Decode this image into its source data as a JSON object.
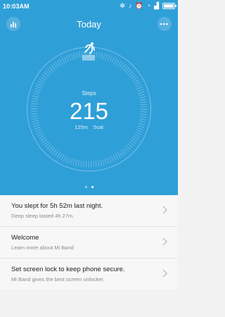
{
  "status": {
    "time": "10:03AM"
  },
  "header": {
    "title": "Today"
  },
  "activity": {
    "steps_label": "Steps",
    "steps": "215",
    "distance": "125m",
    "calories": "5cal",
    "page_count": 2,
    "active_page": 2
  },
  "cards": [
    {
      "title": "You slept for 5h 52m last night.",
      "subtitle": "Deep sleep lasted 4h 27m."
    },
    {
      "title": "Welcome",
      "subtitle": "Learn more about Mi Band"
    },
    {
      "title": "Set screen lock to keep phone secure.",
      "subtitle": "Mi Band gives the best screen unlocker."
    }
  ],
  "colors": {
    "hero": "#2f9fd8",
    "ring": "#ffffff"
  },
  "icons": {
    "stats": "bar-chart-icon",
    "more": "more-icon",
    "runner": "runner-icon",
    "chevron": "chevron-right-icon"
  }
}
